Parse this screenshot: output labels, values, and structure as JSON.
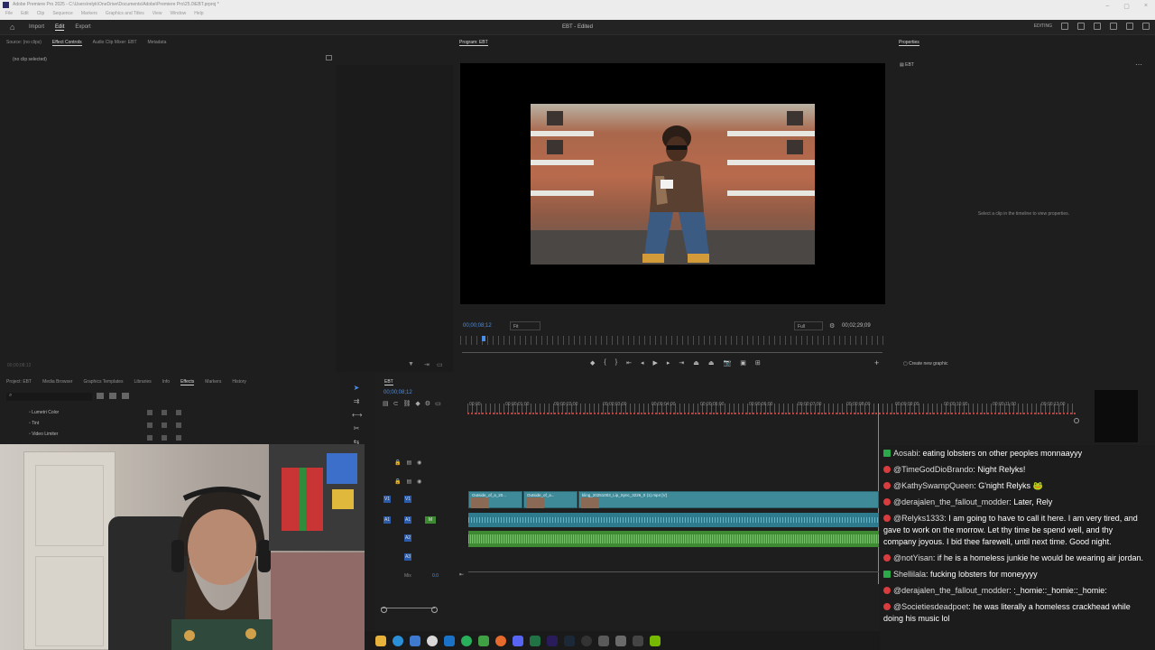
{
  "titlebar": {
    "title": "Adobe Premiere Pro 2025 - C:\\Users\\relyk\\OneDrive\\Documents\\Adobe\\Premiere Pro\\25.0\\EBT.prproj *",
    "menu": [
      "File",
      "Edit",
      "Clip",
      "Sequence",
      "Markers",
      "Graphics and Titles",
      "View",
      "Window",
      "Help"
    ]
  },
  "header": {
    "nav": [
      "Import",
      "Edit",
      "Export"
    ],
    "active_nav": "Edit",
    "document_title": "EBT - Edited",
    "workspace": "EDITING"
  },
  "source_panel": {
    "tabs": [
      "Source: (no clips)",
      "Effect Controls",
      "Audio Clip Mixer: EBT",
      "Metadata"
    ],
    "active_tab": "Effect Controls",
    "no_clip": "(no clip selected)",
    "timecode": "00;00;08;12"
  },
  "program_monitor": {
    "tab": "Program: EBT",
    "timecode_current": "00;00;08;12",
    "fit": "Fit",
    "quality": "Full",
    "timecode_duration": "00;02;29;09"
  },
  "properties_panel": {
    "tab": "Properties",
    "item": "EBT",
    "hint": "Select a clip in the timeline to view properties.",
    "create_graphic": "Create new graphic"
  },
  "project_panel": {
    "tabs": [
      "Project: EBT",
      "Media Browser",
      "Graphics Templates",
      "Libraries",
      "Info",
      "Effects",
      "Markers",
      "History"
    ],
    "active_tab": "Effects",
    "items": [
      "Lumetri Color",
      "Tint",
      "Video Limiter"
    ]
  },
  "timeline": {
    "tab": "EBT",
    "timecode": "00;00;08;12",
    "ruler": [
      "00;00",
      "00;00;01;00",
      "00;00;02;00",
      "00;00;03;00",
      "00;00;04;00",
      "00;00;05;00",
      "00;00;06;00",
      "00;00;07;00",
      "00;00;08;00",
      "00;00;09;00",
      "00;00;10;00",
      "00;00;11;00",
      "00;00;12;00"
    ],
    "tracks": [
      "V3",
      "V2",
      "V1",
      "A1",
      "A2",
      "A3",
      "Mix"
    ],
    "mix_value": "0.0",
    "clips": [
      "Outside_of_a_20...",
      "Outside_of_a...",
      "kling_20251003_Lip_Sync_3226_0 (1).mp4 [V]"
    ]
  },
  "chat": [
    {
      "badge": "green",
      "user": "Aosabi",
      "text": "eating lobsters on other peoples monnaayyy"
    },
    {
      "badge": "red",
      "user": "@TimeGodDioBrando",
      "text": "Night Relyks!"
    },
    {
      "badge": "red",
      "user": "@KathySwampQueen",
      "text": "G'night Relyks 🐸"
    },
    {
      "badge": "red",
      "user": "@derajalen_the_fallout_modder",
      "text": "Later, Rely"
    },
    {
      "badge": "red",
      "user": "@Relyks1333",
      "text": "I am going to have to call it here. I am very tired, and gave to work on the morrow. Let thy time be spend well, and thy company joyous. I bid thee farewell, until next time. Good night."
    },
    {
      "badge": "red",
      "user": "@notYisan",
      "text": "if he is a homeless junkie he would be wearing air jordan."
    },
    {
      "badge": "green",
      "user": "Shellilala",
      "text": "fucking lobsters for moneyyyy"
    },
    {
      "badge": "red",
      "user": "@derajalen_the_fallout_modder",
      "text": ":_homie::_homie::_homie:"
    },
    {
      "badge": "red",
      "user": "@Societiesdeadpoet",
      "text": "he was literally a homeless crackhead while doing his music lol"
    }
  ],
  "colors": {
    "accent_blue": "#4a8ee8",
    "video_clip": "#3f8a99",
    "audio_a1": "#2e7b8e",
    "audio_a2": "#3e8a33",
    "badge_green": "#2ba84a",
    "badge_red": "#d83c3c"
  },
  "taskbar_icons": [
    "folder-icon",
    "edge-icon",
    "explorer-icon",
    "chrome-icon",
    "mail-icon",
    "spotify-icon",
    "xbox-icon",
    "firefox-icon",
    "discord-icon",
    "excel-icon",
    "premiere-icon",
    "steam-icon",
    "obs-icon"
  ]
}
